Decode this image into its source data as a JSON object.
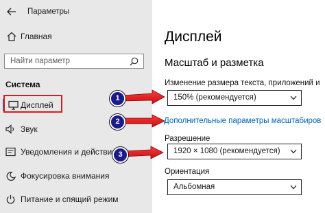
{
  "window": {
    "title": "Параметры"
  },
  "sidebar": {
    "home_label": "Главная",
    "search_placeholder": "Найти параметр",
    "section_label": "Система",
    "items": [
      {
        "label": "Дисплей",
        "icon": "monitor-icon",
        "selected": true
      },
      {
        "label": "Звук",
        "icon": "speaker-icon"
      },
      {
        "label": "Уведомления и действия",
        "icon": "notifications-icon"
      },
      {
        "label": "Фокусировка внимания",
        "icon": "moon-icon"
      },
      {
        "label": "Питание и спящий режим",
        "icon": "power-icon"
      }
    ]
  },
  "main": {
    "title": "Дисплей",
    "section_title": "Масштаб и разметка",
    "scale_label": "Изменение размера текста, приложений и др",
    "scale_value": "150% (рекомендуется)",
    "advanced_link": "Дополнительные параметры масштабирован",
    "resolution_label": "Разрешение",
    "resolution_value": "1920 × 1080 (рекомендуется)",
    "orientation_label": "Ориентация",
    "orientation_value": "Альбомная"
  },
  "callouts": [
    "1",
    "2",
    "3"
  ],
  "colors": {
    "accent": "#0078d7",
    "callout_arrow": "#e0181f",
    "callout_badge": "#1a1a8a",
    "link": "#0063b1"
  }
}
